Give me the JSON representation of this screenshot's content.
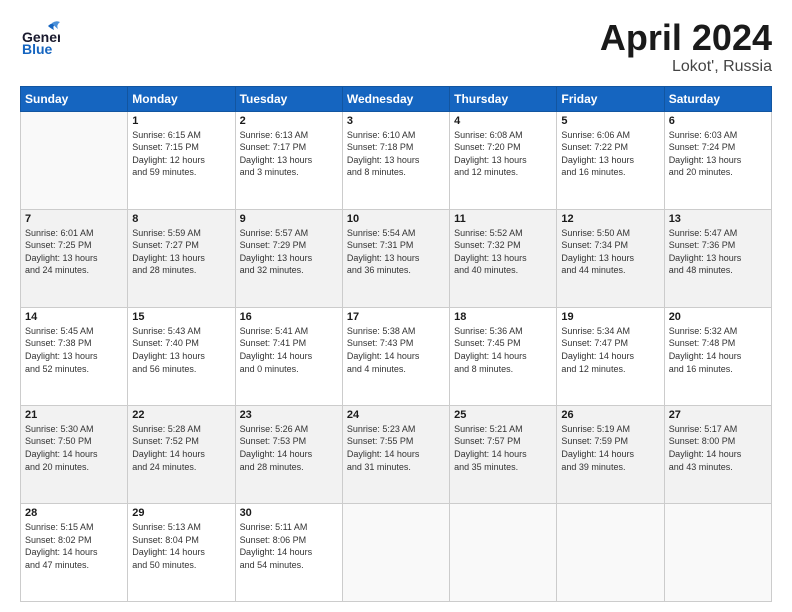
{
  "header": {
    "logo_general": "General",
    "logo_blue": "Blue",
    "month_title": "April 2024",
    "subtitle": "Lokot', Russia"
  },
  "calendar": {
    "headers": [
      "Sunday",
      "Monday",
      "Tuesday",
      "Wednesday",
      "Thursday",
      "Friday",
      "Saturday"
    ],
    "rows": [
      [
        {
          "num": "",
          "info": ""
        },
        {
          "num": "1",
          "info": "Sunrise: 6:15 AM\nSunset: 7:15 PM\nDaylight: 12 hours\nand 59 minutes."
        },
        {
          "num": "2",
          "info": "Sunrise: 6:13 AM\nSunset: 7:17 PM\nDaylight: 13 hours\nand 3 minutes."
        },
        {
          "num": "3",
          "info": "Sunrise: 6:10 AM\nSunset: 7:18 PM\nDaylight: 13 hours\nand 8 minutes."
        },
        {
          "num": "4",
          "info": "Sunrise: 6:08 AM\nSunset: 7:20 PM\nDaylight: 13 hours\nand 12 minutes."
        },
        {
          "num": "5",
          "info": "Sunrise: 6:06 AM\nSunset: 7:22 PM\nDaylight: 13 hours\nand 16 minutes."
        },
        {
          "num": "6",
          "info": "Sunrise: 6:03 AM\nSunset: 7:24 PM\nDaylight: 13 hours\nand 20 minutes."
        }
      ],
      [
        {
          "num": "7",
          "info": "Sunrise: 6:01 AM\nSunset: 7:25 PM\nDaylight: 13 hours\nand 24 minutes."
        },
        {
          "num": "8",
          "info": "Sunrise: 5:59 AM\nSunset: 7:27 PM\nDaylight: 13 hours\nand 28 minutes."
        },
        {
          "num": "9",
          "info": "Sunrise: 5:57 AM\nSunset: 7:29 PM\nDaylight: 13 hours\nand 32 minutes."
        },
        {
          "num": "10",
          "info": "Sunrise: 5:54 AM\nSunset: 7:31 PM\nDaylight: 13 hours\nand 36 minutes."
        },
        {
          "num": "11",
          "info": "Sunrise: 5:52 AM\nSunset: 7:32 PM\nDaylight: 13 hours\nand 40 minutes."
        },
        {
          "num": "12",
          "info": "Sunrise: 5:50 AM\nSunset: 7:34 PM\nDaylight: 13 hours\nand 44 minutes."
        },
        {
          "num": "13",
          "info": "Sunrise: 5:47 AM\nSunset: 7:36 PM\nDaylight: 13 hours\nand 48 minutes."
        }
      ],
      [
        {
          "num": "14",
          "info": "Sunrise: 5:45 AM\nSunset: 7:38 PM\nDaylight: 13 hours\nand 52 minutes."
        },
        {
          "num": "15",
          "info": "Sunrise: 5:43 AM\nSunset: 7:40 PM\nDaylight: 13 hours\nand 56 minutes."
        },
        {
          "num": "16",
          "info": "Sunrise: 5:41 AM\nSunset: 7:41 PM\nDaylight: 14 hours\nand 0 minutes."
        },
        {
          "num": "17",
          "info": "Sunrise: 5:38 AM\nSunset: 7:43 PM\nDaylight: 14 hours\nand 4 minutes."
        },
        {
          "num": "18",
          "info": "Sunrise: 5:36 AM\nSunset: 7:45 PM\nDaylight: 14 hours\nand 8 minutes."
        },
        {
          "num": "19",
          "info": "Sunrise: 5:34 AM\nSunset: 7:47 PM\nDaylight: 14 hours\nand 12 minutes."
        },
        {
          "num": "20",
          "info": "Sunrise: 5:32 AM\nSunset: 7:48 PM\nDaylight: 14 hours\nand 16 minutes."
        }
      ],
      [
        {
          "num": "21",
          "info": "Sunrise: 5:30 AM\nSunset: 7:50 PM\nDaylight: 14 hours\nand 20 minutes."
        },
        {
          "num": "22",
          "info": "Sunrise: 5:28 AM\nSunset: 7:52 PM\nDaylight: 14 hours\nand 24 minutes."
        },
        {
          "num": "23",
          "info": "Sunrise: 5:26 AM\nSunset: 7:53 PM\nDaylight: 14 hours\nand 28 minutes."
        },
        {
          "num": "24",
          "info": "Sunrise: 5:23 AM\nSunset: 7:55 PM\nDaylight: 14 hours\nand 31 minutes."
        },
        {
          "num": "25",
          "info": "Sunrise: 5:21 AM\nSunset: 7:57 PM\nDaylight: 14 hours\nand 35 minutes."
        },
        {
          "num": "26",
          "info": "Sunrise: 5:19 AM\nSunset: 7:59 PM\nDaylight: 14 hours\nand 39 minutes."
        },
        {
          "num": "27",
          "info": "Sunrise: 5:17 AM\nSunset: 8:00 PM\nDaylight: 14 hours\nand 43 minutes."
        }
      ],
      [
        {
          "num": "28",
          "info": "Sunrise: 5:15 AM\nSunset: 8:02 PM\nDaylight: 14 hours\nand 47 minutes."
        },
        {
          "num": "29",
          "info": "Sunrise: 5:13 AM\nSunset: 8:04 PM\nDaylight: 14 hours\nand 50 minutes."
        },
        {
          "num": "30",
          "info": "Sunrise: 5:11 AM\nSunset: 8:06 PM\nDaylight: 14 hours\nand 54 minutes."
        },
        {
          "num": "",
          "info": ""
        },
        {
          "num": "",
          "info": ""
        },
        {
          "num": "",
          "info": ""
        },
        {
          "num": "",
          "info": ""
        }
      ]
    ]
  }
}
